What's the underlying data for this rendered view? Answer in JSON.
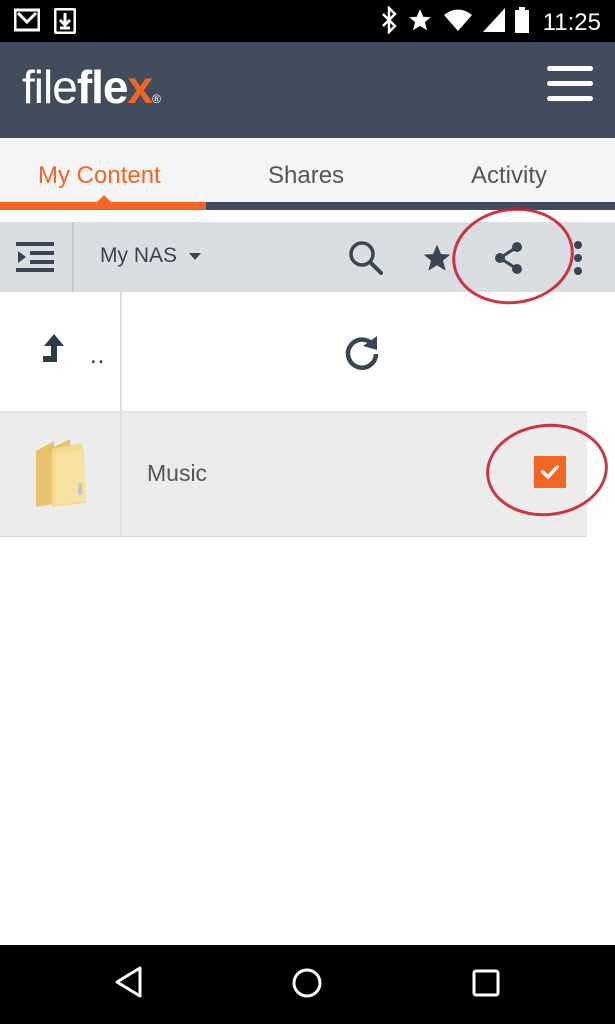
{
  "status_bar": {
    "time": "11:25",
    "left_icons": [
      "gmail-icon",
      "download-icon"
    ],
    "right_icons": [
      "bluetooth-icon",
      "star-icon",
      "wifi-icon",
      "signal-icon",
      "battery-icon"
    ]
  },
  "header": {
    "logo_part1": "file",
    "logo_part2": "fle",
    "logo_part3": "x",
    "logo_mark": "®",
    "menu_icon": "hamburger-menu-icon"
  },
  "tabs": [
    {
      "label": "My Content",
      "active": true
    },
    {
      "label": "Shares",
      "active": false
    },
    {
      "label": "Activity",
      "active": false
    }
  ],
  "toolbar": {
    "location": "My NAS",
    "icons": [
      "sidebar-toggle-icon",
      "search-icon",
      "star-icon",
      "share-icon",
      "more-vertical-icon"
    ]
  },
  "file_list": {
    "parent_label": "..",
    "items": [
      {
        "name": "Music",
        "type": "folder",
        "selected": true
      }
    ]
  },
  "colors": {
    "accent": "#f26522",
    "header_bg": "#414d5d",
    "toolbar_bg": "#dadde1",
    "annotation": "#c8202e"
  }
}
